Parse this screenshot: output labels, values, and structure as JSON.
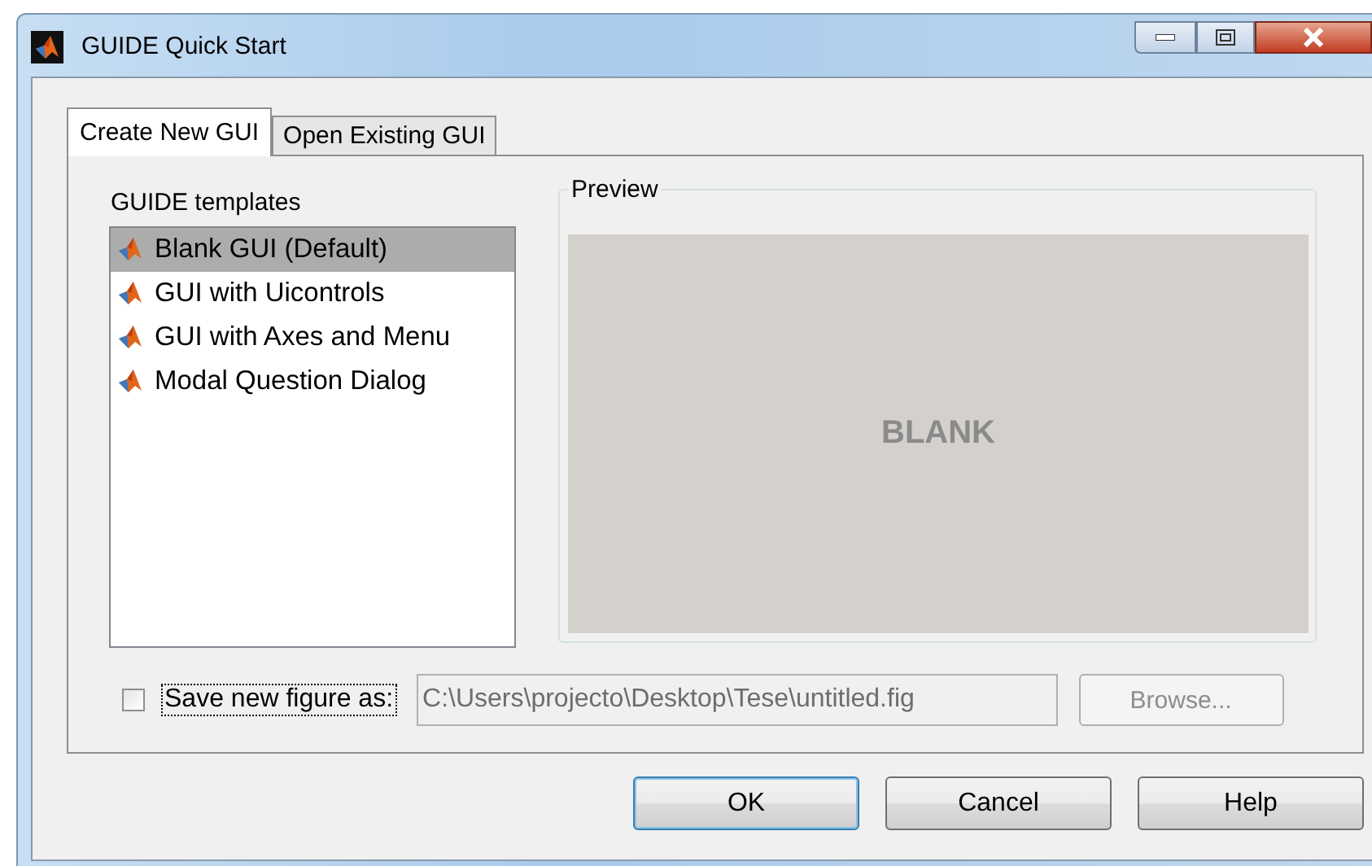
{
  "window": {
    "title": "GUIDE Quick Start"
  },
  "tabs": [
    {
      "label": "Create New GUI",
      "selected": true
    },
    {
      "label": "Open Existing GUI",
      "selected": false
    }
  ],
  "templates": {
    "label": "GUIDE templates",
    "items": [
      {
        "label": "Blank GUI (Default)",
        "selected": true
      },
      {
        "label": "GUI with Uicontrols",
        "selected": false
      },
      {
        "label": "GUI with Axes and Menu",
        "selected": false
      },
      {
        "label": "Modal Question Dialog",
        "selected": false
      }
    ]
  },
  "preview": {
    "label": "Preview",
    "text": "BLANK"
  },
  "save": {
    "label": "Save new figure as:",
    "checked": false,
    "value": "C:\\Users\\projecto\\Desktop\\Tese\\untitled.fig",
    "disabled": true,
    "browse": "Browse..."
  },
  "buttons": [
    {
      "label": "OK",
      "default": true
    },
    {
      "label": "Cancel",
      "default": false
    },
    {
      "label": "Help",
      "default": false
    }
  ]
}
